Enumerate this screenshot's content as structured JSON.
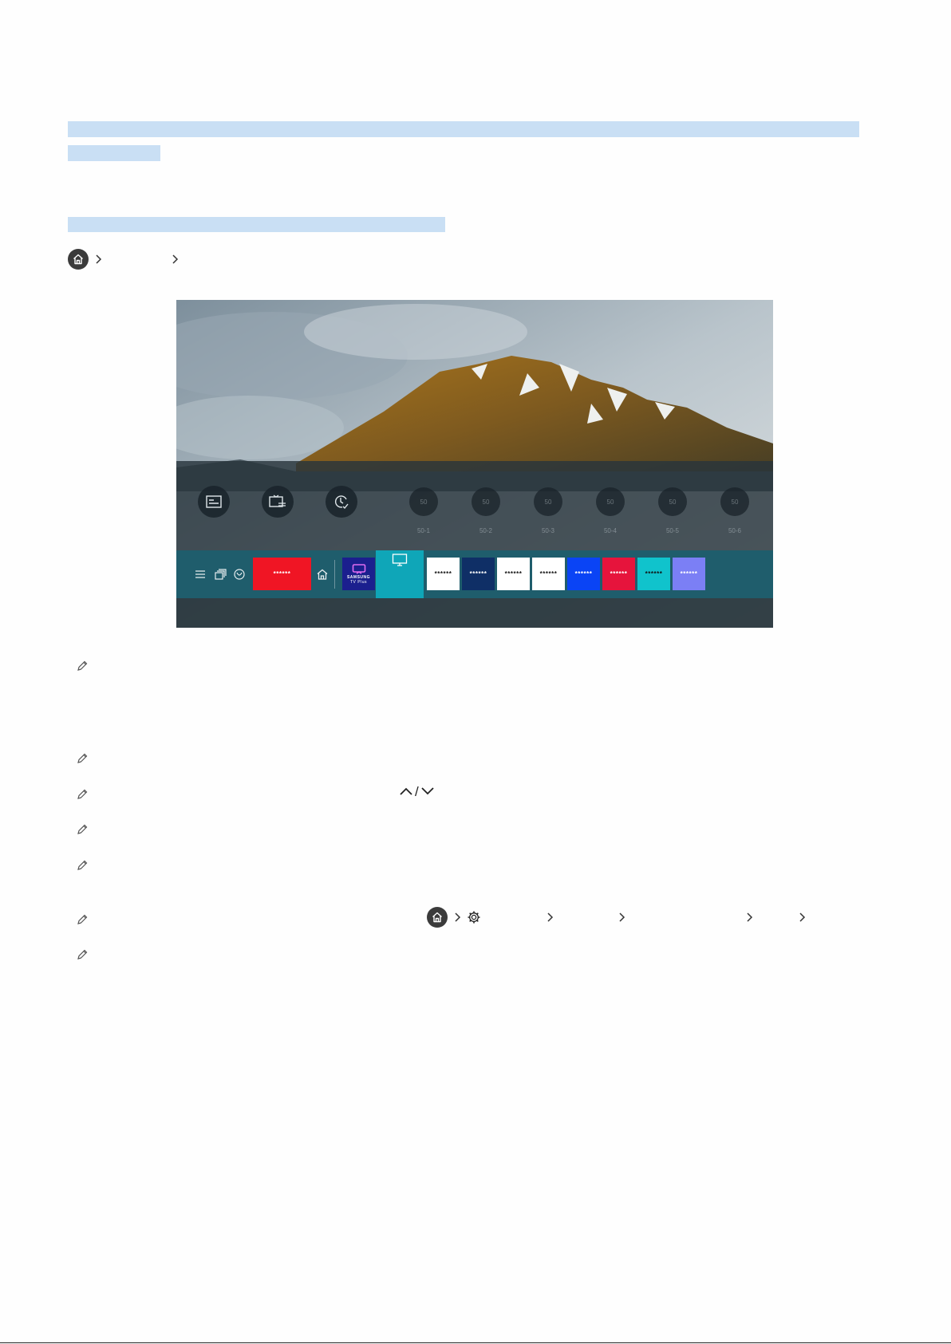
{
  "tv": {
    "bar_tiles": [
      {
        "label": "******",
        "bg": "#f01524",
        "fg": "#ffffff"
      },
      {
        "label": "******",
        "bg": "#ffffff",
        "fg": "#111111"
      },
      {
        "label": "******",
        "bg": "#0f2f66",
        "fg": "#ffffff"
      },
      {
        "label": "******",
        "bg": "#ffffff",
        "fg": "#111111"
      },
      {
        "label": "******",
        "bg": "#ffffff",
        "fg": "#111111"
      },
      {
        "label": "******",
        "bg": "#0a44f5",
        "fg": "#ffffff"
      },
      {
        "label": "******",
        "bg": "#e6143c",
        "fg": "#ffffff"
      },
      {
        "label": "******",
        "bg": "#10c3cc",
        "fg": "#111111"
      },
      {
        "label": "******",
        "bg": "#7b7ff5",
        "fg": "#ffffff"
      }
    ],
    "samsung_tv_plus": {
      "brand": "SAMSUNG",
      "sub": "TV Plus",
      "bg": "#1b1f8e"
    },
    "channels": [
      {
        "num": "50",
        "label": "50-1"
      },
      {
        "num": "50",
        "label": "50-2"
      },
      {
        "num": "50",
        "label": "50-3"
      },
      {
        "num": "50",
        "label": "50-4"
      },
      {
        "num": "50",
        "label": "50-5"
      },
      {
        "num": "50",
        "label": "50-6"
      }
    ]
  },
  "icons": {
    "breadcrumb_home": "home-icon",
    "note": "pencil-icon",
    "settings": "gear-icon"
  },
  "colors": {
    "highlight": "#c9dff4",
    "active_tile": "#0fa6b8",
    "bar": "#1f5d6c"
  }
}
